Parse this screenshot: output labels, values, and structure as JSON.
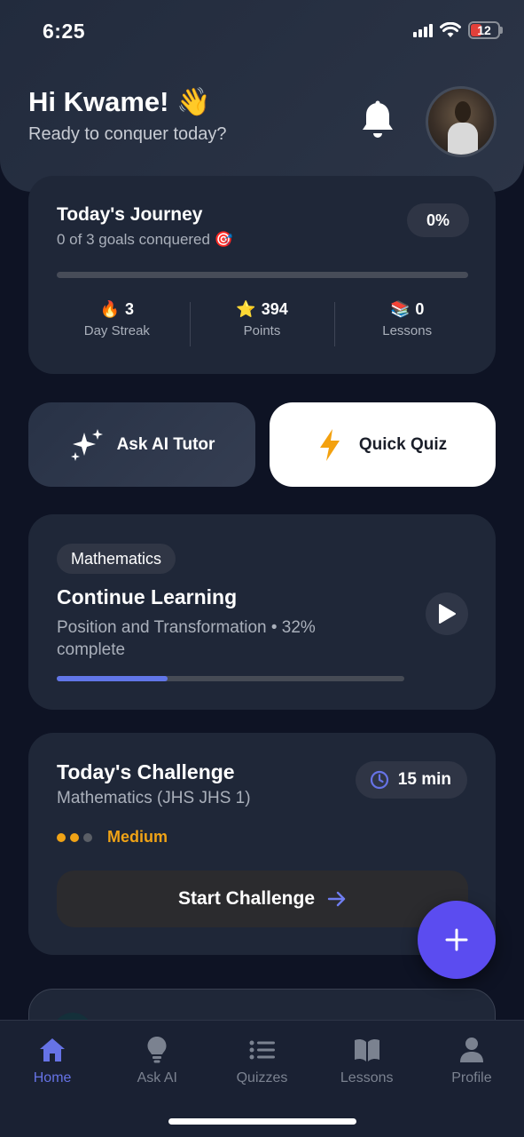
{
  "status_bar": {
    "time": "6:25",
    "battery": "12"
  },
  "header": {
    "greeting": "Hi Kwame! 👋",
    "subtitle": "Ready to conquer today?"
  },
  "journey": {
    "title": "Today's Journey",
    "subtitle": "0 of 3 goals conquered 🎯",
    "percent_label": "0%",
    "progress": 0,
    "stats": [
      {
        "icon": "🔥",
        "value": "3",
        "label": "Day Streak"
      },
      {
        "icon": "⭐",
        "value": "394",
        "label": "Points"
      },
      {
        "icon": "📚",
        "value": "0",
        "label": "Lessons"
      }
    ]
  },
  "actions": {
    "ask_ai": "Ask AI Tutor",
    "quick_quiz": "Quick Quiz"
  },
  "continue_learning": {
    "subject": "Mathematics",
    "title": "Continue Learning",
    "description": "Position and Transformation • 32% complete",
    "progress": 0.32
  },
  "challenge": {
    "title": "Today's Challenge",
    "subtitle": "Mathematics (JHS JHS 1)",
    "duration": "15 min",
    "difficulty": "Medium",
    "difficulty_level": 2,
    "button": "Start Challenge"
  },
  "tabs": [
    {
      "label": "Home",
      "icon": "home-icon",
      "active": true
    },
    {
      "label": "Ask AI",
      "icon": "lightbulb-icon",
      "active": false
    },
    {
      "label": "Quizzes",
      "icon": "list-icon",
      "active": false
    },
    {
      "label": "Lessons",
      "icon": "book-icon",
      "active": false
    },
    {
      "label": "Profile",
      "icon": "person-icon",
      "active": false
    }
  ],
  "colors": {
    "accent": "#5b4cf0",
    "tab_active": "#6673e6",
    "difficulty": "#f0a316",
    "progress": "#6176e8"
  }
}
